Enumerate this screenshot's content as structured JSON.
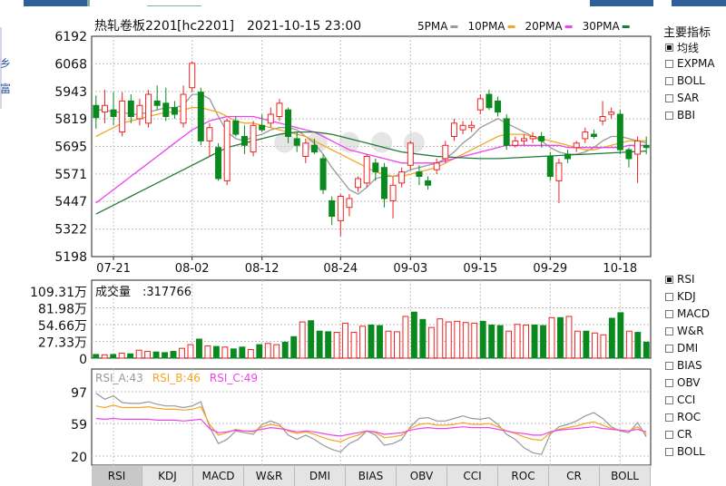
{
  "header": {
    "symbol_name": "热轧卷板2201",
    "code": "[hc2201]",
    "datetime": "2021-10-15 23:00"
  },
  "ma_legend": [
    {
      "label": "5PMA",
      "color": "#999999"
    },
    {
      "label": "10PMA",
      "color": "#f5a623"
    },
    {
      "label": "20PMA",
      "color": "#ee44ee"
    },
    {
      "label": "30PMA",
      "color": "#1e7a3a"
    }
  ],
  "colors": {
    "up": "#ee2222",
    "down": "#0a8a1e",
    "grid": "#c0c0c0",
    "axis": "#222222"
  },
  "left_strip": {
    "char1": "乡",
    "char2": "富"
  },
  "side_controls": {
    "title": "主要指标",
    "main": [
      {
        "label": "均线",
        "checked": true
      },
      {
        "label": "EXPMA",
        "checked": false
      },
      {
        "label": "BOLL",
        "checked": false
      },
      {
        "label": "SAR",
        "checked": false
      },
      {
        "label": "BBI",
        "checked": false
      }
    ],
    "sub": [
      {
        "label": "RSI",
        "checked": true
      },
      {
        "label": "KDJ",
        "checked": false
      },
      {
        "label": "MACD",
        "checked": false
      },
      {
        "label": "W&R",
        "checked": false
      },
      {
        "label": "DMI",
        "checked": false
      },
      {
        "label": "BIAS",
        "checked": false
      },
      {
        "label": "OBV",
        "checked": false
      },
      {
        "label": "CCI",
        "checked": false
      },
      {
        "label": "ROC",
        "checked": false
      },
      {
        "label": "CR",
        "checked": false
      },
      {
        "label": "BOLL",
        "checked": false
      }
    ]
  },
  "tabs": [
    {
      "label": "RSI",
      "active": true
    },
    {
      "label": "KDJ",
      "active": false
    },
    {
      "label": "MACD",
      "active": false
    },
    {
      "label": "W&R",
      "active": false
    },
    {
      "label": "DMI",
      "active": false
    },
    {
      "label": "BIAS",
      "active": false
    },
    {
      "label": "OBV",
      "active": false
    },
    {
      "label": "CCI",
      "active": false
    },
    {
      "label": "ROC",
      "active": false
    },
    {
      "label": "CR",
      "active": false
    },
    {
      "label": "BOLL",
      "active": false
    }
  ],
  "chart_data": [
    {
      "type": "candlestick",
      "yticks": [
        6192,
        6068,
        5943,
        5819,
        5695,
        5571,
        5447,
        5322,
        5198
      ],
      "ylim": [
        5198,
        6192
      ],
      "xticks": [
        {
          "label": "07-21",
          "index": 2
        },
        {
          "label": "08-02",
          "index": 11
        },
        {
          "label": "08-12",
          "index": 19
        },
        {
          "label": "08-24",
          "index": 28
        },
        {
          "label": "09-03",
          "index": 36
        },
        {
          "label": "09-15",
          "index": 44
        },
        {
          "label": "09-29",
          "index": 52
        },
        {
          "label": "10-18",
          "index": 60
        }
      ],
      "candles": [
        [
          5880,
          5825,
          5925,
          5775
        ],
        [
          5850,
          5880,
          5950,
          5800
        ],
        [
          5860,
          5830,
          5940,
          5790
        ],
        [
          5760,
          5900,
          5940,
          5740
        ],
        [
          5900,
          5830,
          5930,
          5800
        ],
        [
          5820,
          5880,
          5910,
          5790
        ],
        [
          5800,
          5930,
          5950,
          5780
        ],
        [
          5900,
          5880,
          5970,
          5860
        ],
        [
          5890,
          5830,
          5960,
          5810
        ],
        [
          5870,
          5840,
          5900,
          5820
        ],
        [
          5800,
          5930,
          5970,
          5780
        ],
        [
          5960,
          6070,
          6080,
          5940
        ],
        [
          5940,
          5720,
          5960,
          5700
        ],
        [
          5720,
          5780,
          5800,
          5650
        ],
        [
          5690,
          5550,
          5710,
          5540
        ],
        [
          5540,
          5810,
          5820,
          5520
        ],
        [
          5810,
          5750,
          5830,
          5740
        ],
        [
          5740,
          5700,
          5790,
          5660
        ],
        [
          5670,
          5790,
          5810,
          5650
        ],
        [
          5790,
          5770,
          5840,
          5760
        ],
        [
          5800,
          5840,
          5870,
          5780
        ],
        [
          5830,
          5890,
          5910,
          5810
        ],
        [
          5860,
          5740,
          5870,
          5710
        ],
        [
          5730,
          5700,
          5760,
          5670
        ],
        [
          5650,
          5710,
          5730,
          5620
        ],
        [
          5700,
          5670,
          5730,
          5660
        ],
        [
          5640,
          5500,
          5660,
          5480
        ],
        [
          5450,
          5380,
          5470,
          5340
        ],
        [
          5360,
          5470,
          5480,
          5290
        ],
        [
          5420,
          5460,
          5480,
          5380
        ],
        [
          5510,
          5550,
          5560,
          5490
        ],
        [
          5530,
          5650,
          5660,
          5510
        ],
        [
          5620,
          5580,
          5640,
          5540
        ],
        [
          5600,
          5460,
          5620,
          5420
        ],
        [
          5450,
          5520,
          5560,
          5370
        ],
        [
          5530,
          5580,
          5600,
          5510
        ],
        [
          5610,
          5710,
          5720,
          5590
        ],
        [
          5580,
          5560,
          5610,
          5520
        ],
        [
          5540,
          5520,
          5560,
          5500
        ],
        [
          5590,
          5620,
          5640,
          5570
        ],
        [
          5640,
          5700,
          5720,
          5620
        ],
        [
          5740,
          5800,
          5820,
          5720
        ],
        [
          5770,
          5790,
          5810,
          5750
        ],
        [
          5780,
          5790,
          5810,
          5760
        ],
        [
          5860,
          5910,
          5930,
          5840
        ],
        [
          5930,
          5870,
          5950,
          5860
        ],
        [
          5900,
          5850,
          5920,
          5830
        ],
        [
          5820,
          5700,
          5840,
          5680
        ],
        [
          5700,
          5720,
          5740,
          5690
        ],
        [
          5720,
          5730,
          5750,
          5700
        ],
        [
          5730,
          5740,
          5760,
          5710
        ],
        [
          5740,
          5720,
          5760,
          5690
        ],
        [
          5650,
          5560,
          5670,
          5540
        ],
        [
          5540,
          5620,
          5640,
          5440
        ],
        [
          5660,
          5640,
          5680,
          5620
        ],
        [
          5690,
          5710,
          5720,
          5670
        ],
        [
          5730,
          5760,
          5780,
          5710
        ],
        [
          5750,
          5740,
          5770,
          5730
        ],
        [
          5810,
          5830,
          5900,
          5790
        ],
        [
          5840,
          5850,
          5870,
          5820
        ],
        [
          5840,
          5680,
          5860,
          5660
        ],
        [
          5680,
          5640,
          5690,
          5600
        ],
        [
          5660,
          5720,
          5740,
          5530
        ],
        [
          5700,
          5690,
          5740,
          5660
        ]
      ],
      "ma5": [
        5860,
        5860,
        5850,
        5850,
        5840,
        5840,
        5850,
        5860,
        5870,
        5870,
        5880,
        5930,
        5930,
        5910,
        5830,
        5760,
        5730,
        5720,
        5740,
        5750,
        5770,
        5780,
        5780,
        5770,
        5740,
        5710,
        5660,
        5600,
        5550,
        5500,
        5480,
        5510,
        5550,
        5560,
        5560,
        5570,
        5590,
        5600,
        5610,
        5620,
        5640,
        5670,
        5710,
        5740,
        5780,
        5800,
        5820,
        5800,
        5780,
        5760,
        5740,
        5720,
        5690,
        5670,
        5660,
        5660,
        5670,
        5690,
        5720,
        5740,
        5740,
        5730,
        5720,
        5710
      ],
      "ma10": [
        5740,
        5760,
        5780,
        5800,
        5810,
        5820,
        5830,
        5840,
        5850,
        5850,
        5860,
        5870,
        5870,
        5860,
        5850,
        5830,
        5810,
        5800,
        5800,
        5790,
        5780,
        5770,
        5760,
        5750,
        5740,
        5720,
        5700,
        5680,
        5660,
        5640,
        5620,
        5600,
        5580,
        5570,
        5560,
        5560,
        5570,
        5580,
        5590,
        5600,
        5620,
        5640,
        5660,
        5680,
        5700,
        5720,
        5740,
        5750,
        5750,
        5750,
        5740,
        5730,
        5720,
        5710,
        5700,
        5690,
        5680,
        5680,
        5690,
        5700,
        5710,
        5720,
        5720,
        5720
      ],
      "ma20": [
        5440,
        5470,
        5500,
        5530,
        5560,
        5590,
        5620,
        5650,
        5680,
        5710,
        5740,
        5770,
        5790,
        5810,
        5820,
        5830,
        5830,
        5830,
        5830,
        5820,
        5810,
        5800,
        5790,
        5780,
        5770,
        5760,
        5740,
        5720,
        5700,
        5680,
        5670,
        5660,
        5650,
        5640,
        5630,
        5620,
        5620,
        5620,
        5620,
        5620,
        5630,
        5640,
        5650,
        5660,
        5670,
        5680,
        5690,
        5700,
        5700,
        5700,
        5700,
        5700,
        5700,
        5700,
        5690,
        5690,
        5690,
        5690,
        5690,
        5690,
        5690,
        5700,
        5700,
        5700
      ],
      "ma30": [
        5390,
        5410,
        5430,
        5450,
        5470,
        5490,
        5510,
        5530,
        5550,
        5570,
        5590,
        5610,
        5630,
        5650,
        5670,
        5690,
        5700,
        5710,
        5720,
        5730,
        5740,
        5750,
        5755,
        5760,
        5760,
        5760,
        5755,
        5750,
        5740,
        5730,
        5720,
        5710,
        5700,
        5690,
        5680,
        5670,
        5665,
        5660,
        5655,
        5650,
        5648,
        5646,
        5644,
        5642,
        5640,
        5640,
        5640,
        5642,
        5644,
        5646,
        5648,
        5650,
        5652,
        5654,
        5656,
        5658,
        5660,
        5662,
        5664,
        5666,
        5668,
        5670,
        5672,
        5674
      ]
    },
    {
      "type": "bar",
      "title": "成交量",
      "title_value": "317766",
      "yticks": [
        "109.31万",
        "81.98万",
        "54.66万",
        "27.33万",
        "0"
      ],
      "ylim": [
        0,
        1093100
      ],
      "values": [
        60000,
        55000,
        60000,
        80000,
        70000,
        130000,
        110000,
        100000,
        90000,
        110000,
        160000,
        220000,
        310000,
        200000,
        190000,
        180000,
        150000,
        180000,
        140000,
        220000,
        240000,
        220000,
        260000,
        350000,
        590000,
        610000,
        440000,
        430000,
        420000,
        570000,
        420000,
        520000,
        540000,
        530000,
        440000,
        430000,
        680000,
        750000,
        630000,
        500000,
        640000,
        590000,
        600000,
        580000,
        570000,
        600000,
        540000,
        530000,
        440000,
        550000,
        540000,
        540000,
        530000,
        660000,
        660000,
        680000,
        440000,
        440000,
        410000,
        380000,
        650000,
        740000,
        440000,
        420000,
        260000
      ]
    },
    {
      "type": "line",
      "title": "RSI",
      "series": [
        {
          "name": "RSI_A",
          "label": "43",
          "color": "#999999",
          "values": [
            95,
            88,
            92,
            84,
            83,
            83,
            85,
            82,
            80,
            80,
            78,
            80,
            85,
            55,
            35,
            40,
            50,
            48,
            46,
            58,
            62,
            58,
            45,
            40,
            45,
            40,
            33,
            28,
            25,
            35,
            40,
            50,
            45,
            33,
            35,
            40,
            55,
            65,
            66,
            62,
            62,
            65,
            68,
            65,
            64,
            66,
            58,
            46,
            40,
            30,
            24,
            22,
            46,
            55,
            58,
            62,
            68,
            72,
            65,
            55,
            50,
            48,
            60,
            43
          ]
        },
        {
          "name": "RSI_B",
          "label": "46",
          "color": "#f5a623",
          "values": [
            80,
            78,
            81,
            78,
            78,
            78,
            79,
            77,
            76,
            76,
            75,
            76,
            79,
            58,
            45,
            48,
            52,
            50,
            49,
            55,
            58,
            56,
            50,
            47,
            49,
            46,
            42,
            39,
            37,
            42,
            45,
            50,
            48,
            42,
            43,
            45,
            53,
            58,
            59,
            57,
            57,
            58,
            60,
            58,
            58,
            59,
            55,
            50,
            47,
            43,
            40,
            39,
            48,
            52,
            54,
            56,
            59,
            61,
            57,
            53,
            51,
            50,
            55,
            46
          ]
        },
        {
          "name": "RSI_C",
          "label": "49",
          "color": "#ee44ee",
          "values": [
            65,
            64,
            65,
            64,
            64,
            64,
            64,
            63,
            63,
            63,
            62,
            63,
            64,
            53,
            48,
            49,
            51,
            50,
            50,
            52,
            54,
            53,
            51,
            49,
            50,
            49,
            47,
            45,
            44,
            46,
            48,
            50,
            49,
            46,
            47,
            48,
            51,
            53,
            54,
            53,
            53,
            54,
            55,
            54,
            54,
            54,
            52,
            50,
            48,
            47,
            45,
            45,
            49,
            51,
            52,
            53,
            54,
            55,
            53,
            52,
            51,
            50,
            52,
            49
          ]
        }
      ],
      "yticks": [
        97,
        59,
        20
      ],
      "ylim": [
        20,
        97
      ]
    }
  ]
}
